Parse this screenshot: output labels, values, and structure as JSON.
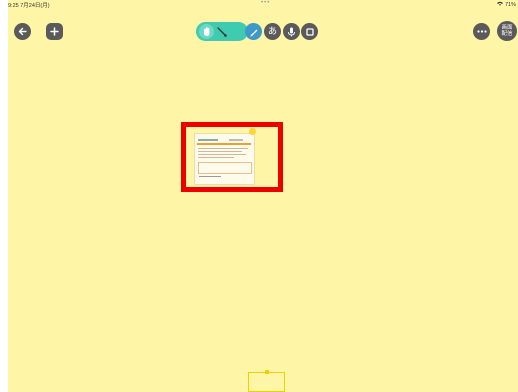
{
  "status_bar": {
    "time": "9:25",
    "date": "7月24日(月)",
    "battery": "71%"
  },
  "toolbar": {
    "left_icons": [
      "back-arrow-icon",
      "plus-icon"
    ],
    "tools": [
      "hand-icon",
      "lasso-icon",
      "pen-icon",
      "kana-icon",
      "microphone-icon",
      "square-icon"
    ],
    "kana_label": "あ",
    "right_icons": [
      "more-icon"
    ],
    "screen_share_label_1": "画面",
    "screen_share_label_2": "配信"
  },
  "colors": {
    "canvas": "#fff5a6",
    "highlight": "#ee0000",
    "tool_active": "#3ecbb0",
    "pen": "#3d9ac8"
  }
}
